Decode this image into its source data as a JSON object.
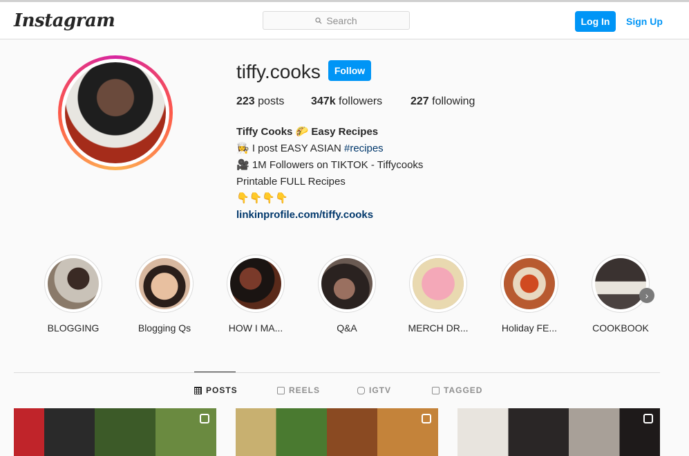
{
  "header": {
    "logo": "Instagram",
    "search_placeholder": "Search",
    "login_label": "Log In",
    "signup_label": "Sign Up"
  },
  "profile": {
    "username": "tiffy.cooks",
    "follow_label": "Follow",
    "stats": [
      {
        "count": "223",
        "label": "posts"
      },
      {
        "count": "347k",
        "label": "followers"
      },
      {
        "count": "227",
        "label": "following"
      }
    ],
    "bio": {
      "name": "Tiffy Cooks 🌮 Easy Recipes",
      "line1": "👩‍🍳 I post EASY ASIAN ",
      "line1_tag": "#recipes",
      "line2": "🎥 1M Followers on TIKTOK - Tiffycooks",
      "line3": "Printable FULL Recipes",
      "line4": "👇👇👇👇",
      "link": "linkinprofile.com/tiffy.cooks"
    }
  },
  "highlights": [
    {
      "label": "BLOGGING",
      "color": "#8a7a6a"
    },
    {
      "label": "Blogging Qs",
      "color": "#d8b8a0"
    },
    {
      "label": "HOW I MA...",
      "color": "#5a2a1a"
    },
    {
      "label": "Q&A",
      "color": "#3a2e2a"
    },
    {
      "label": "MERCH DR...",
      "color": "#f4a8b8"
    },
    {
      "label": "Holiday FE...",
      "color": "#b85a30"
    },
    {
      "label": "COOKBOOK",
      "color": "#4a4240"
    }
  ],
  "tabs": [
    {
      "label": "POSTS",
      "active": true
    },
    {
      "label": "REELS",
      "active": false
    },
    {
      "label": "IGTV",
      "active": false
    },
    {
      "label": "TAGGED",
      "active": false
    }
  ],
  "colors": {
    "accent": "#0095f6",
    "link": "#00376b",
    "border": "#dbdbdb"
  }
}
